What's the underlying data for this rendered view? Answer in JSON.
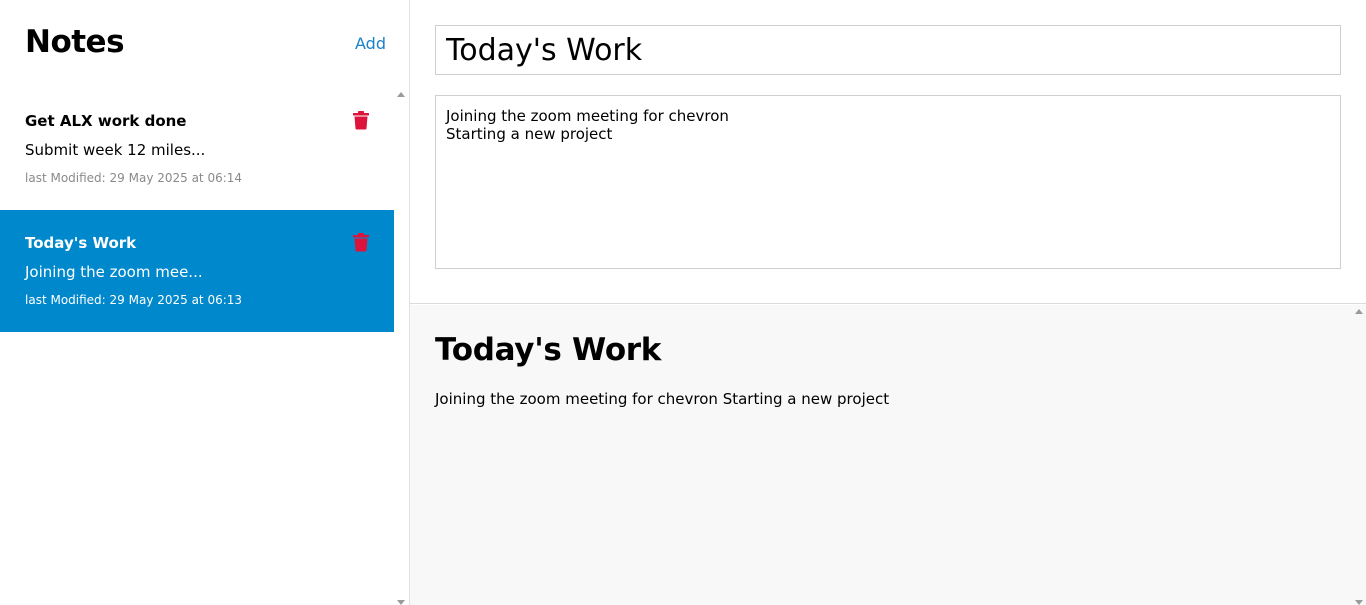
{
  "sidebar": {
    "title": "Notes",
    "add_label": "Add",
    "notes": [
      {
        "title": "Get ALX work done",
        "preview": "Submit week 12 miles...",
        "modified": "last Modified: 29 May 2025 at 06:14",
        "active": false
      },
      {
        "title": "Today's Work",
        "preview": "Joining the zoom mee...",
        "modified": "last Modified: 29 May 2025 at 06:13",
        "active": true
      }
    ]
  },
  "editor": {
    "title_value": "Today's Work",
    "body_value": "Joining the zoom meeting for chevron\nStarting a new project"
  },
  "preview": {
    "title": "Today's Work",
    "body": "Joining the zoom meeting for chevron Starting a new project"
  },
  "icons": {
    "delete": "trash-icon"
  },
  "colors": {
    "accent": "#0088cc",
    "add_link": "#1a82c8",
    "delete": "#dc143c",
    "preview_bg": "#f8f8f8"
  }
}
